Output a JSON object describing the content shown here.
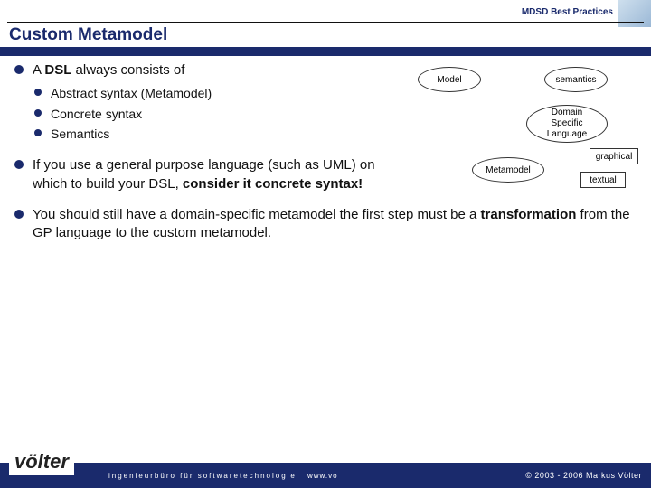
{
  "header": {
    "label": "MDSD Best Practices"
  },
  "title": "Custom Metamodel",
  "bullets": {
    "b1_pre": "A ",
    "b1_bold": "DSL",
    "b1_post": " always consists of",
    "b1_sub1": "Abstract syntax (Metamodel)",
    "b1_sub2": "Concrete syntax",
    "b1_sub3": "Semantics",
    "b2_pre": "If you use a general purpose language (such as UML) on which to build your DSL, ",
    "b2_bold": "consider it concrete syntax!",
    "b3_pre": "You should still have a domain-specific metamodel the first step must be a ",
    "b3_bold": "transformation",
    "b3_post": " from the GP language to the custom metamodel."
  },
  "diagram": {
    "model": "Model",
    "semantics": "semantics",
    "dsl": "Domain\nSpecific\nLanguage",
    "metamodel": "Metamodel",
    "graphical": "graphical",
    "textual": "textual"
  },
  "logo": {
    "name": "völter",
    "dot": "•"
  },
  "footer": {
    "tagline": "ingenieurbüro für softwaretechnologie",
    "url": "www.vo",
    "copyright": "© 2003 - 2006 Markus Völter"
  }
}
